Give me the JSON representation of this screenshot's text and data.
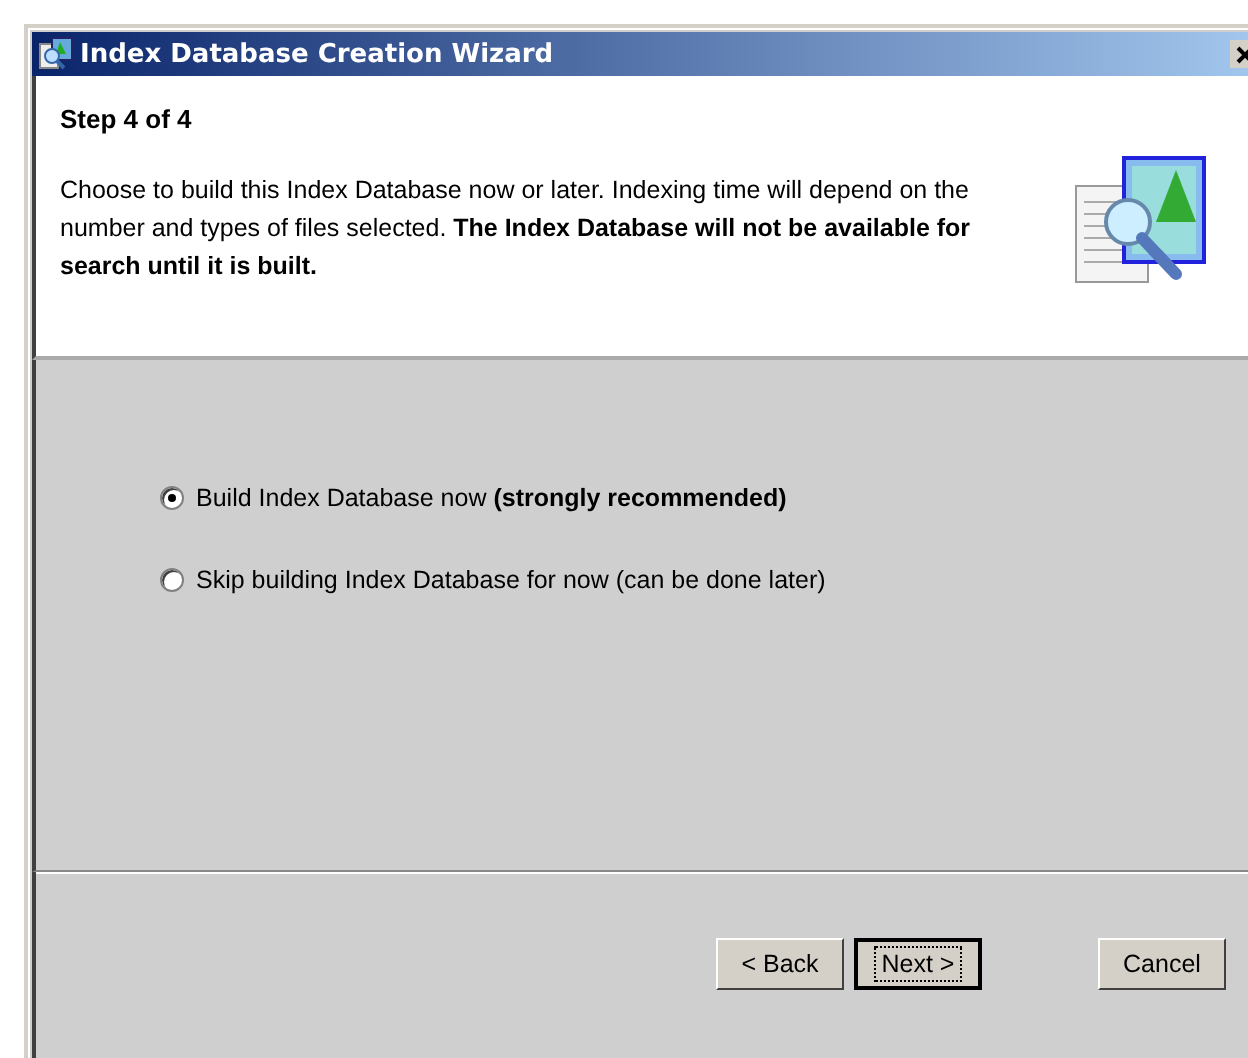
{
  "window": {
    "title": "Index Database Creation Wizard"
  },
  "header": {
    "step": "Step 4 of 4",
    "description": "Choose to build this Index Database now or later. Indexing time will depend on the number and types of files selected. **The Index Database will not be available for search until it is built.**"
  },
  "options": [
    {
      "label": "Build Index Database now **(strongly recommended)**",
      "selected": true
    },
    {
      "label": "Skip building Index Database for now (can be done later)",
      "selected": false
    }
  ],
  "buttons": [
    {
      "label": "< Back",
      "kind": "back",
      "focused": false
    },
    {
      "label": "Next >",
      "kind": "next",
      "focused": true
    },
    {
      "label": "Cancel",
      "kind": "cancel",
      "focused": false
    }
  ]
}
